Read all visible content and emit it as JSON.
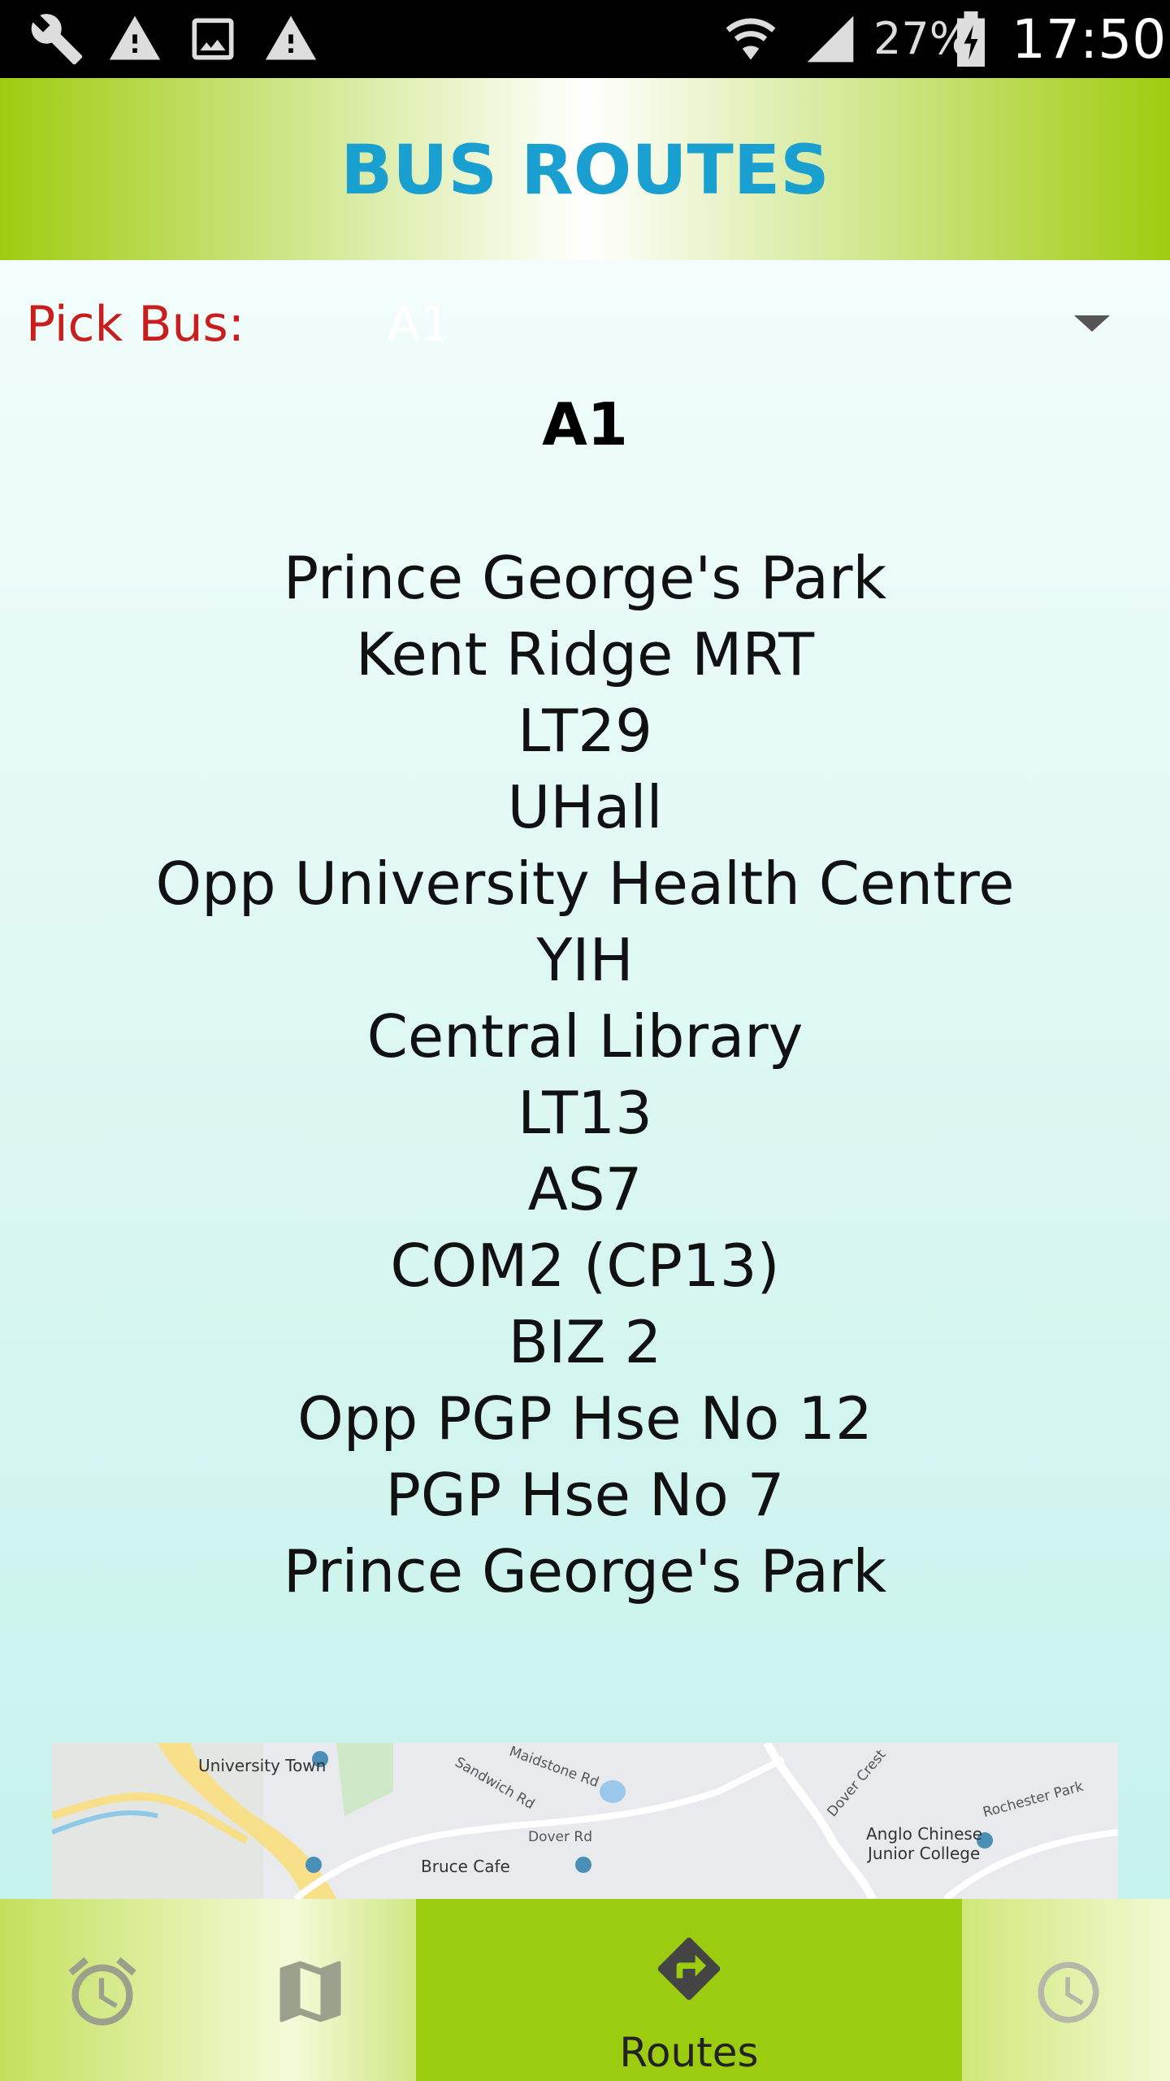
{
  "status_bar": {
    "battery_percent": "27%",
    "time": "17:50"
  },
  "header": {
    "title": "BUS ROUTES"
  },
  "picker": {
    "label": "Pick Bus:",
    "selected": "A1"
  },
  "route": {
    "name": "A1",
    "stops": [
      "Prince George's Park",
      "Kent Ridge MRT",
      "LT29",
      "UHall",
      "Opp University Health Centre",
      "YIH",
      "Central Library",
      "LT13",
      "AS7",
      "COM2 (CP13)",
      "BIZ 2",
      "Opp PGP Hse No 12",
      "PGP Hse No 7",
      "Prince George's Park"
    ]
  },
  "map": {
    "labels": {
      "university_town": "University Town",
      "bruce_cafe": "Bruce Cafe",
      "dover_rd": "Dover Rd",
      "anglo_chinese": "Anglo Chinese",
      "junior_college": "Junior College",
      "sandwich_rd": "Sandwich Rd",
      "maidstone_rd": "Maidstone Rd",
      "dover_crest": "Dover Crest",
      "rochester_park": "Rochester Park"
    }
  },
  "bottom_nav": {
    "items": [
      {
        "icon": "alarm-clock-icon"
      },
      {
        "icon": "map-icon"
      },
      {
        "icon": "directions-icon",
        "label": "Routes",
        "active": true
      },
      {
        "icon": "clock-icon"
      }
    ]
  },
  "colors": {
    "header_green": "#9fcc10",
    "title_blue": "#1aa0d0",
    "pick_label_red": "#c81e1e",
    "content_bg": "#d8f6f1",
    "nav_active": "#9bcc10"
  }
}
